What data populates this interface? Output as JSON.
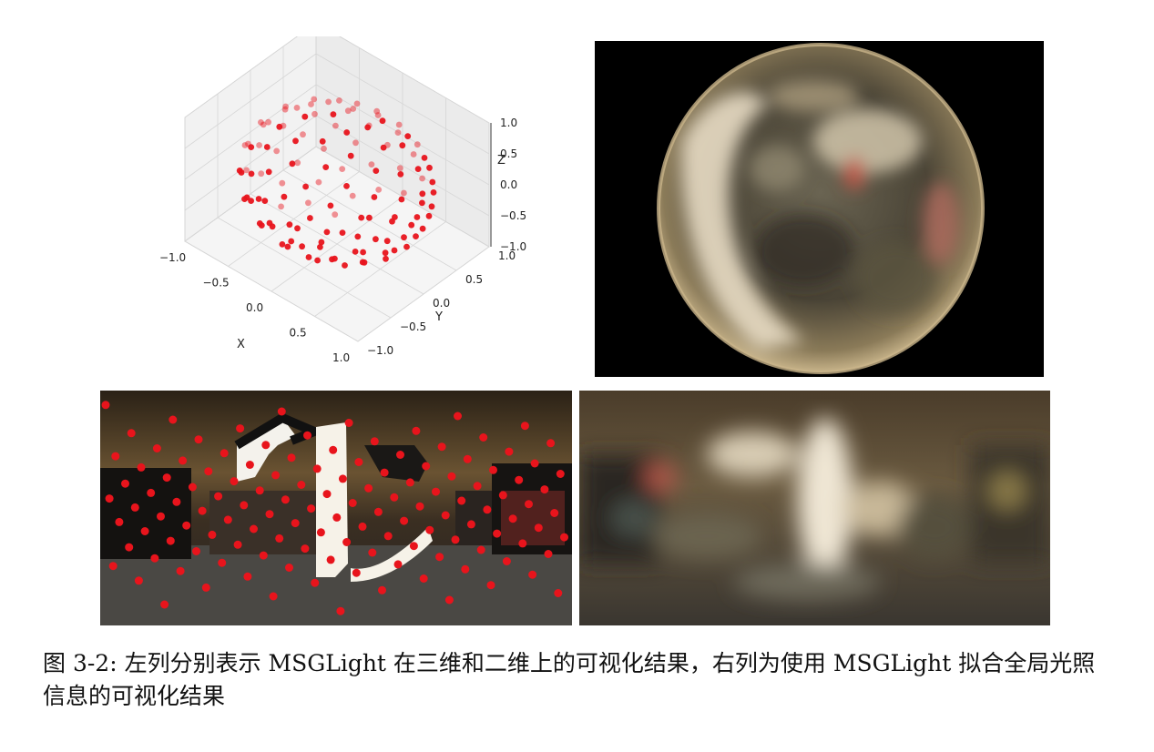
{
  "figure": {
    "caption": "图 3-2: 左列分别表示 MSGLight 在三维和二维上的可视化结果，右列为使用 MSGLight 拟合全局光照信息的可视化结果",
    "plot3d": {
      "axis_labels": {
        "x": "X",
        "y": "Y",
        "z": "Z"
      },
      "x_ticks": [
        "−1.0",
        "−0.5",
        "0.0",
        "0.5",
        "1.0"
      ],
      "y_ticks": [
        "1.0",
        "0.5",
        "0.0",
        "−0.5",
        "−1.0"
      ],
      "z_ticks": [
        "1.0",
        "0.5",
        "0.0",
        "−0.5",
        "−1.0"
      ],
      "point_color": "#e8141c"
    },
    "panels": [
      "3d-scatter-plot",
      "rendered-sphere",
      "panorama-with-light-points",
      "blurred-fitted-panorama"
    ]
  },
  "chart_data": {
    "type": "scatter",
    "title": "",
    "xlabel": "X",
    "ylabel": "Y",
    "zlabel": "Z",
    "xlim": [
      -1.0,
      1.0
    ],
    "ylim": [
      -1.0,
      1.0
    ],
    "zlim": [
      -1.0,
      1.0
    ],
    "grid": true,
    "points_description": "approximately 128 red points distributed uniformly on the surface of the unit sphere"
  }
}
